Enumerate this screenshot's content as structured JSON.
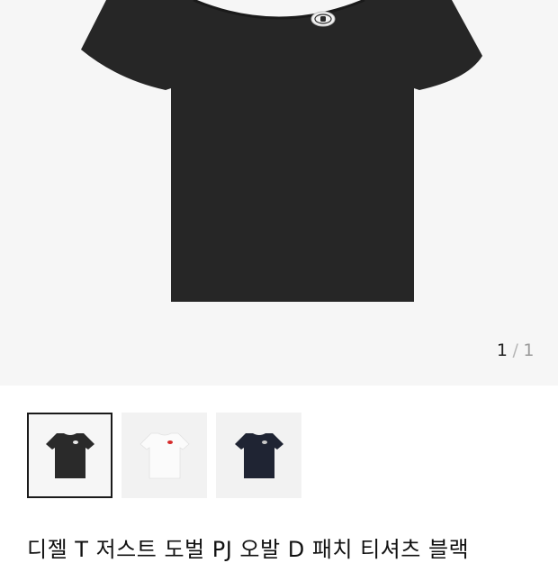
{
  "pager": {
    "current": "1",
    "separator": "/",
    "total": "1"
  },
  "product": {
    "title": "디젤 T 저스트 도벌 PJ 오발 D 패치 티셔츠 블랙"
  },
  "thumbnails": [
    {
      "label": "black",
      "color": "#2a2a2a",
      "patch": "#e8e8e8",
      "active": true
    },
    {
      "label": "white",
      "color": "#f7f7f7",
      "patch": "#d62b2b",
      "active": false
    },
    {
      "label": "navy",
      "color": "#1f2433",
      "patch": "#c9c9c9",
      "active": false
    }
  ],
  "colors": {
    "shirt_black": "#262626",
    "background": "#f6f6f6",
    "active_border": "#1a1a1a"
  }
}
